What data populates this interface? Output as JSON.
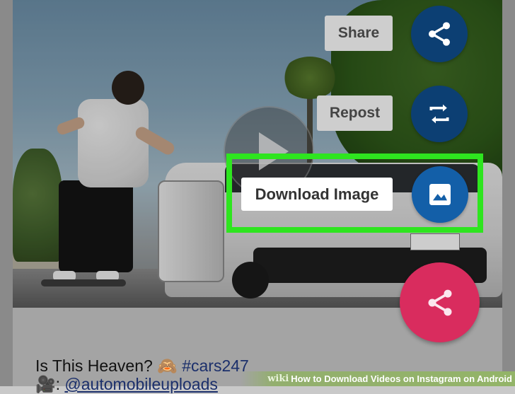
{
  "menu": {
    "share_label": "Share",
    "repost_label": "Repost",
    "download_label": "Download Image"
  },
  "caption": {
    "line1_text": "Is This Heaven? 🙈 ",
    "line1_hashtag": "#cars247",
    "line2_prefix": "🎥: ",
    "line2_mention": "@automobileuploads"
  },
  "watermark": {
    "brand": "wiki",
    "title": "How to Download Videos on Instagram on Android"
  },
  "icons": {
    "share": "share-icon",
    "repost": "repost-icon",
    "download": "image-icon",
    "play": "play-icon"
  },
  "colors": {
    "fab_blue": "#0c3f73",
    "fab_pink": "#d92c5e",
    "highlight": "#2ee51f"
  }
}
